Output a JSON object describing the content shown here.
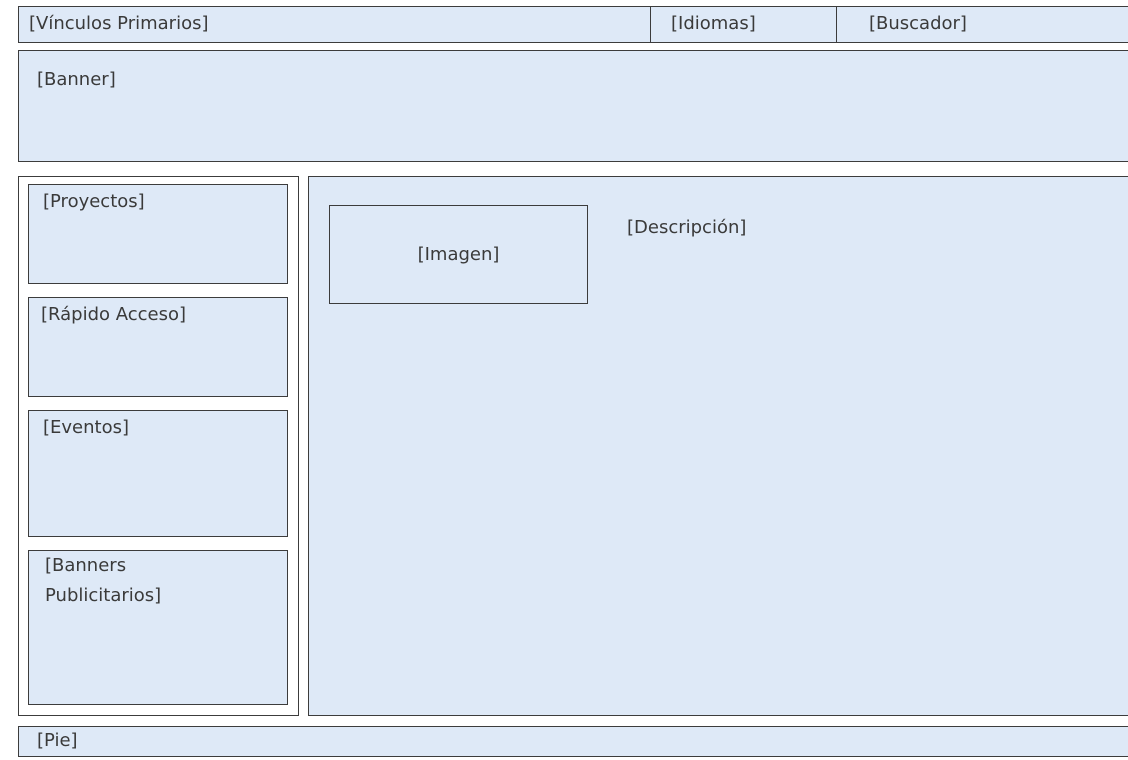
{
  "header": {
    "primary_links": "[Vínculos  Primarios]",
    "languages": "[Idiomas]",
    "search": "[Buscador]"
  },
  "banner": {
    "label": "[Banner]"
  },
  "sidebar": {
    "projects": "[Proyectos]",
    "quick_access": "[Rápido Acceso]",
    "events": "[Eventos]",
    "ad_banners_line1": "[Banners",
    "ad_banners_line2": "Publicitarios]"
  },
  "content": {
    "image": "[Imagen]",
    "description": "[Descripción]"
  },
  "footer": {
    "label": "[Pie]"
  },
  "colors": {
    "panel_fill": "#dee9f7",
    "border": "#3c3c3c",
    "text": "#3a3a3a"
  }
}
